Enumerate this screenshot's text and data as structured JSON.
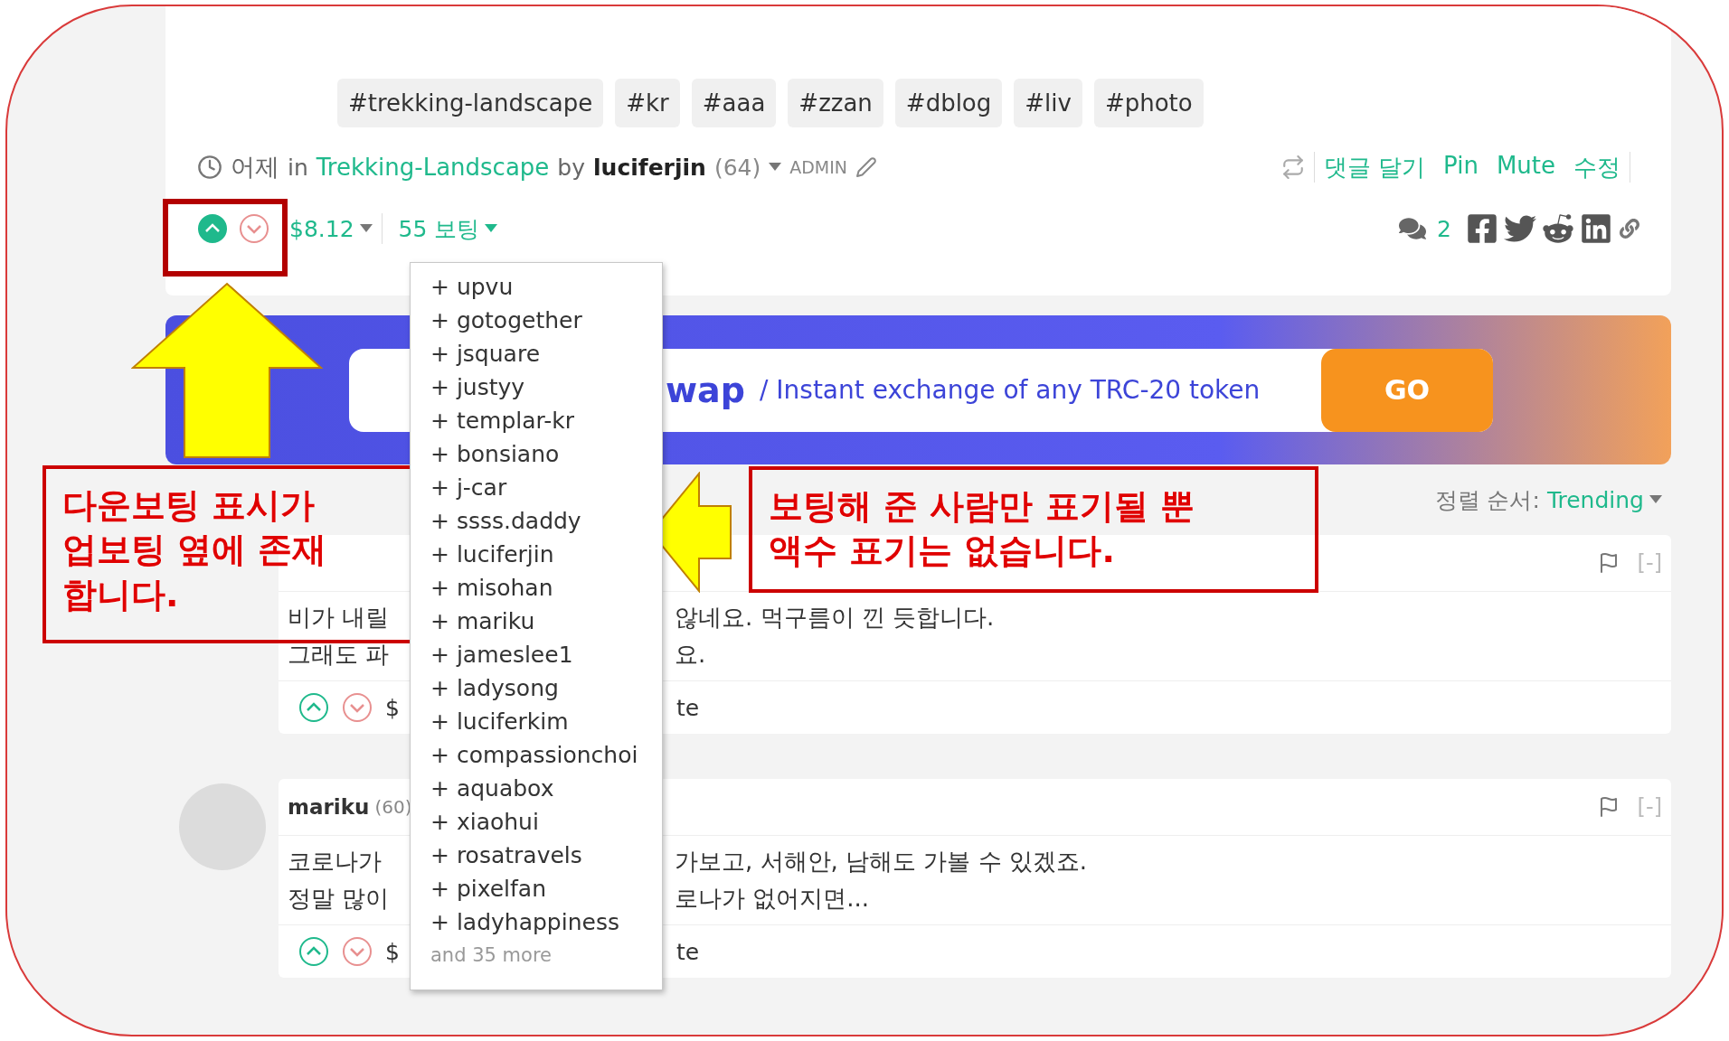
{
  "post": {
    "tags": [
      "#trekking-landscape",
      "#kr",
      "#aaa",
      "#zzan",
      "#dblog",
      "#liv",
      "#photo"
    ],
    "meta": {
      "time": "어제",
      "in": "in",
      "community": "Trekking-Landscape",
      "by": "by",
      "author": "luciferjin",
      "reputation": "(64)",
      "role": "ADMIN"
    },
    "actions": [
      "댓글 달기",
      "Pin",
      "Mute",
      "수정"
    ],
    "votes": {
      "upvoted": true,
      "downvoted": false,
      "payout": "$8.12",
      "vote_count": "55 보팅",
      "comment_count": "2"
    }
  },
  "banner": {
    "title": "wap",
    "tagline": "/ Instant exchange of any TRC-20 token",
    "button": "GO"
  },
  "sort": {
    "label": "정렬 순서:",
    "value": "Trending"
  },
  "comments": [
    {
      "collapse": "[-]",
      "lines": [
        [
          "비가 내릴",
          "않네요. 먹구름이 낀 듯합니다."
        ],
        [
          "그래도 파",
          "요."
        ]
      ],
      "footer": [
        "$",
        "te"
      ],
      "upvoted": false,
      "downvoted": false
    },
    {
      "author": "mariku",
      "reputation": "(60)",
      "collapse": "[-]",
      "lines": [
        [
          "코로나가",
          "가보고, 서해안, 남해도 가볼 수 있겠죠."
        ],
        [
          "정말 많이",
          "로나가 없어지면..."
        ]
      ],
      "footer": [
        "$",
        "te"
      ],
      "upvoted": false,
      "downvoted": false
    }
  ],
  "voters": {
    "items": [
      "+ upvu",
      "+ gotogether",
      "+ jsquare",
      "+ justyy",
      "+ templar-kr",
      "+ bonsiano",
      "+ j-car",
      "+ ssss.daddy",
      "+ luciferjin",
      "+ misohan",
      "+ mariku",
      "+ jameslee1",
      "+ ladysong",
      "+ luciferkim",
      "+ compassionchoi",
      "+ aquabox",
      "+ xiaohui",
      "+ rosatravels",
      "+ pixelfan",
      "+ ladyhappiness"
    ],
    "more": "and 35 more"
  },
  "annotations": [
    {
      "lines": [
        "다운보팅 표시가",
        "업보팅 옆에 존재",
        "합니다."
      ]
    },
    {
      "lines": [
        "보팅해 준 사람만 표기될 뿐",
        "액수 표기는 없습니다."
      ]
    }
  ]
}
